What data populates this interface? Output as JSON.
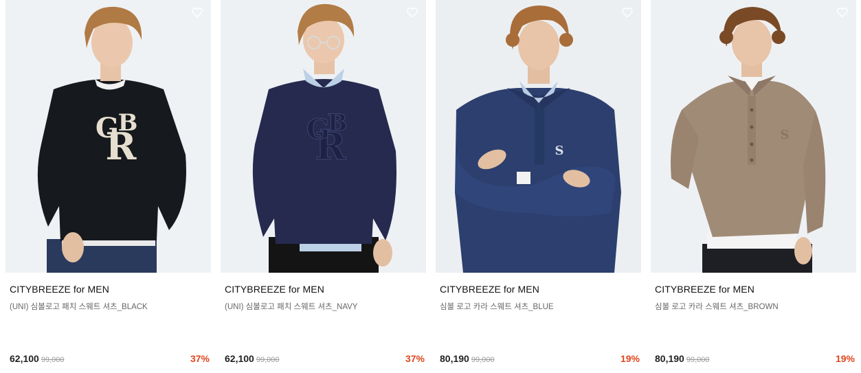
{
  "colors": {
    "discount": "#e0461f",
    "price": "#222222",
    "original_price": "#999999",
    "product_name": "#666666"
  },
  "products": [
    {
      "brand": "CITYBREEZE for MEN",
      "name": "(UNI) 심볼로고 패치 스웨트 셔츠_BLACK",
      "price": "62,100",
      "original_price": "99,000",
      "discount": "37%",
      "wishlist_icon": "heart-outline-icon",
      "garment_color": "#16191d"
    },
    {
      "brand": "CITYBREEZE for MEN",
      "name": "(UNI) 심볼로고 패치 스웨트 셔츠_NAVY",
      "price": "62,100",
      "original_price": "99,000",
      "discount": "37%",
      "wishlist_icon": "heart-outline-icon",
      "garment_color": "#262a4e"
    },
    {
      "brand": "CITYBREEZE for MEN",
      "name": "심볼 로고 카라 스웨트 셔츠_BLUE",
      "price": "80,190",
      "original_price": "99,000",
      "discount": "19%",
      "wishlist_icon": "heart-outline-icon",
      "garment_color": "#2c3f6e"
    },
    {
      "brand": "CITYBREEZE for MEN",
      "name": "심볼 로고 카라 스웨트 셔츠_BROWN",
      "price": "80,190",
      "original_price": "99,000",
      "discount": "19%",
      "wishlist_icon": "heart-outline-icon",
      "garment_color": "#a08b77"
    }
  ]
}
